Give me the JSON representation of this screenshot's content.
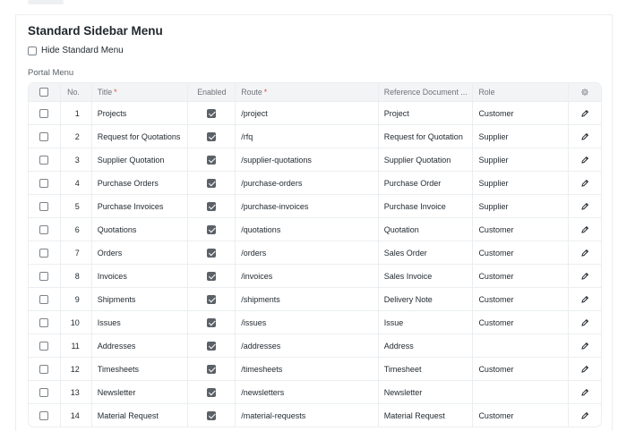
{
  "section": {
    "title": "Standard Sidebar Menu",
    "hide_label": "Hide Standard Menu",
    "hide_checked": false
  },
  "portal": {
    "label": "Portal Menu",
    "columns": {
      "no": "No.",
      "title": "Title",
      "enabled": "Enabled",
      "route": "Route",
      "reference": "Reference Document ...",
      "role": "Role",
      "required_mark": "*"
    },
    "rows": [
      {
        "no": "1",
        "title": "Projects",
        "enabled": true,
        "route": "/project",
        "reference": "Project",
        "role": "Customer"
      },
      {
        "no": "2",
        "title": "Request for Quotations",
        "enabled": true,
        "route": "/rfq",
        "reference": "Request for Quotation",
        "role": "Supplier"
      },
      {
        "no": "3",
        "title": "Supplier Quotation",
        "enabled": true,
        "route": "/supplier-quotations",
        "reference": "Supplier Quotation",
        "role": "Supplier"
      },
      {
        "no": "4",
        "title": "Purchase Orders",
        "enabled": true,
        "route": "/purchase-orders",
        "reference": "Purchase Order",
        "role": "Supplier"
      },
      {
        "no": "5",
        "title": "Purchase Invoices",
        "enabled": true,
        "route": "/purchase-invoices",
        "reference": "Purchase Invoice",
        "role": "Supplier"
      },
      {
        "no": "6",
        "title": "Quotations",
        "enabled": true,
        "route": "/quotations",
        "reference": "Quotation",
        "role": "Customer"
      },
      {
        "no": "7",
        "title": "Orders",
        "enabled": true,
        "route": "/orders",
        "reference": "Sales Order",
        "role": "Customer"
      },
      {
        "no": "8",
        "title": "Invoices",
        "enabled": true,
        "route": "/invoices",
        "reference": "Sales Invoice",
        "role": "Customer"
      },
      {
        "no": "9",
        "title": "Shipments",
        "enabled": true,
        "route": "/shipments",
        "reference": "Delivery Note",
        "role": "Customer"
      },
      {
        "no": "10",
        "title": "Issues",
        "enabled": true,
        "route": "/issues",
        "reference": "Issue",
        "role": "Customer"
      },
      {
        "no": "11",
        "title": "Addresses",
        "enabled": true,
        "route": "/addresses",
        "reference": "Address",
        "role": ""
      },
      {
        "no": "12",
        "title": "Timesheets",
        "enabled": true,
        "route": "/timesheets",
        "reference": "Timesheet",
        "role": "Customer"
      },
      {
        "no": "13",
        "title": "Newsletter",
        "enabled": true,
        "route": "/newsletters",
        "reference": "Newsletter",
        "role": ""
      },
      {
        "no": "14",
        "title": "Material Request",
        "enabled": true,
        "route": "/material-requests",
        "reference": "Material Request",
        "role": "Customer"
      }
    ]
  },
  "colors": {
    "text": "#1f272e",
    "muted": "#6d7378",
    "border": "#ebeef0",
    "header_bg": "#f3f4f5",
    "required": "#e24c4c",
    "checkbox_on": "#5b6167"
  },
  "icons": {
    "row_action": "edit-icon",
    "column_settings": "gear-icon"
  }
}
